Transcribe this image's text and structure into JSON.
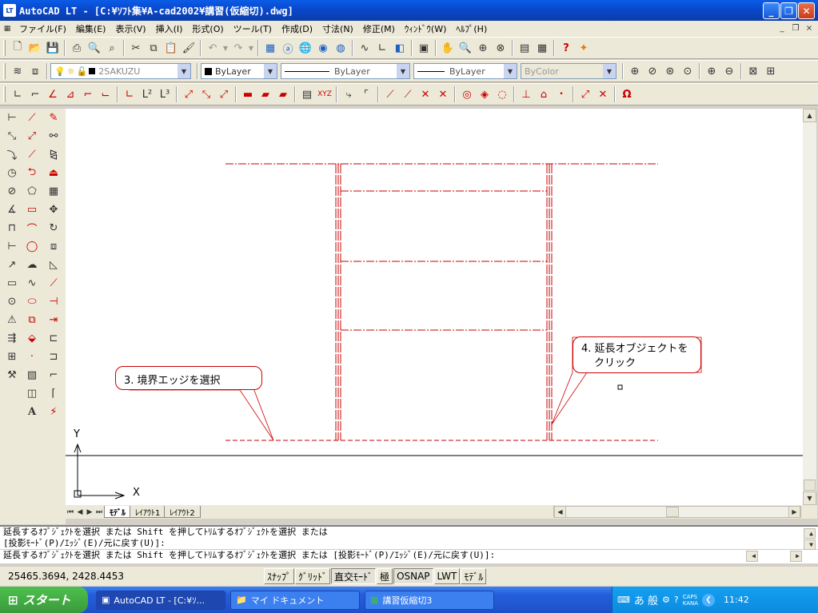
{
  "window": {
    "title": "AutoCAD LT - [C:¥ｿﾌﾄ集¥A-cad2002¥講習(仮縮切).dwg]",
    "app_icon": "LT",
    "buttons": [
      "minimize-icon",
      "restore-icon",
      "close-icon"
    ]
  },
  "menu": {
    "items": [
      "ファイル(F)",
      "編集(E)",
      "表示(V)",
      "挿入(I)",
      "形式(O)",
      "ツール(T)",
      "作成(D)",
      "寸法(N)",
      "修正(M)",
      "ｳｨﾝﾄﾞｳ(W)",
      "ﾍﾙﾌﾟ(H)"
    ],
    "mdi": [
      "_",
      "❐",
      "×"
    ]
  },
  "toolbar1": {
    "icons": [
      "new-icon",
      "open-icon",
      "save-icon",
      "print-icon",
      "preview-icon",
      "find-icon",
      "cut-icon",
      "copy-icon",
      "paste-icon",
      "matchprop-icon",
      "undo-icon",
      "redo-icon",
      "designcenter-icon",
      "internet-icon",
      "hyperlink-icon",
      "browse-icon",
      "globe-icon",
      "tracking-icon",
      "ucs-icon",
      "draworder-icon",
      "properties-icon",
      "pan-icon",
      "zoom-realtime-icon",
      "zoom-window-icon",
      "zoom-previous-icon",
      "table-icon",
      "grid-icon",
      "help-icon",
      "express-icon"
    ]
  },
  "layers": {
    "layer_name": "2SAKUZU",
    "color": "ByLayer",
    "linetype": "ByLayer",
    "lineweight": "ByLayer",
    "plotstyle": "ByColor"
  },
  "command": {
    "lines": [
      "延長するｵﾌﾞｼﾞｪｸﾄを選択 または Shift を押してﾄﾘﾑするｵﾌﾞｼﾞｪｸﾄを選択 または",
      "[投影ﾓｰﾄﾞ(P)/ｴｯｼﾞ(E)/元に戻す(U)]:",
      "延長するｵﾌﾞｼﾞｪｸﾄを選択 または Shift を押してﾄﾘﾑするｵﾌﾞｼﾞｪｸﾄを選択 または [投影ﾓｰﾄﾞ(P)/ｴｯｼﾞ(E)/元に戻す(U)]:"
    ]
  },
  "status": {
    "coords": "25465.3694, 2428.4453",
    "buttons": [
      "ｽﾅｯﾌﾟ",
      "ｸﾞﾘｯﾄﾞ",
      "直交ﾓｰﾄﾞ",
      "極",
      "OSNAP",
      "LWT",
      "ﾓﾃﾞﾙ"
    ]
  },
  "tabs": [
    "ﾓﾃﾞﾙ",
    "ﾚｲｱｳﾄ1",
    "ﾚｲｱｳﾄ2"
  ],
  "canvas": {
    "callout1": "3. 境界エッジを選択",
    "callout2_line1": "4. 延長オブジェクトを",
    "callout2_line2": "クリック",
    "ucs_y": "Y",
    "ucs_x": "X"
  },
  "taskbar": {
    "start": "スタート",
    "tasks": [
      "AutoCAD LT - [C:¥ｿ...",
      "マイ ドキュメント",
      "講習仮縮切3"
    ],
    "tray_caps": "CAPS",
    "tray_kana": "KANA",
    "tray_ime": "あ 般",
    "clock": "11:42"
  },
  "colors": {
    "drawing_red": "#c80000",
    "titlebar": "#0a46c8"
  }
}
